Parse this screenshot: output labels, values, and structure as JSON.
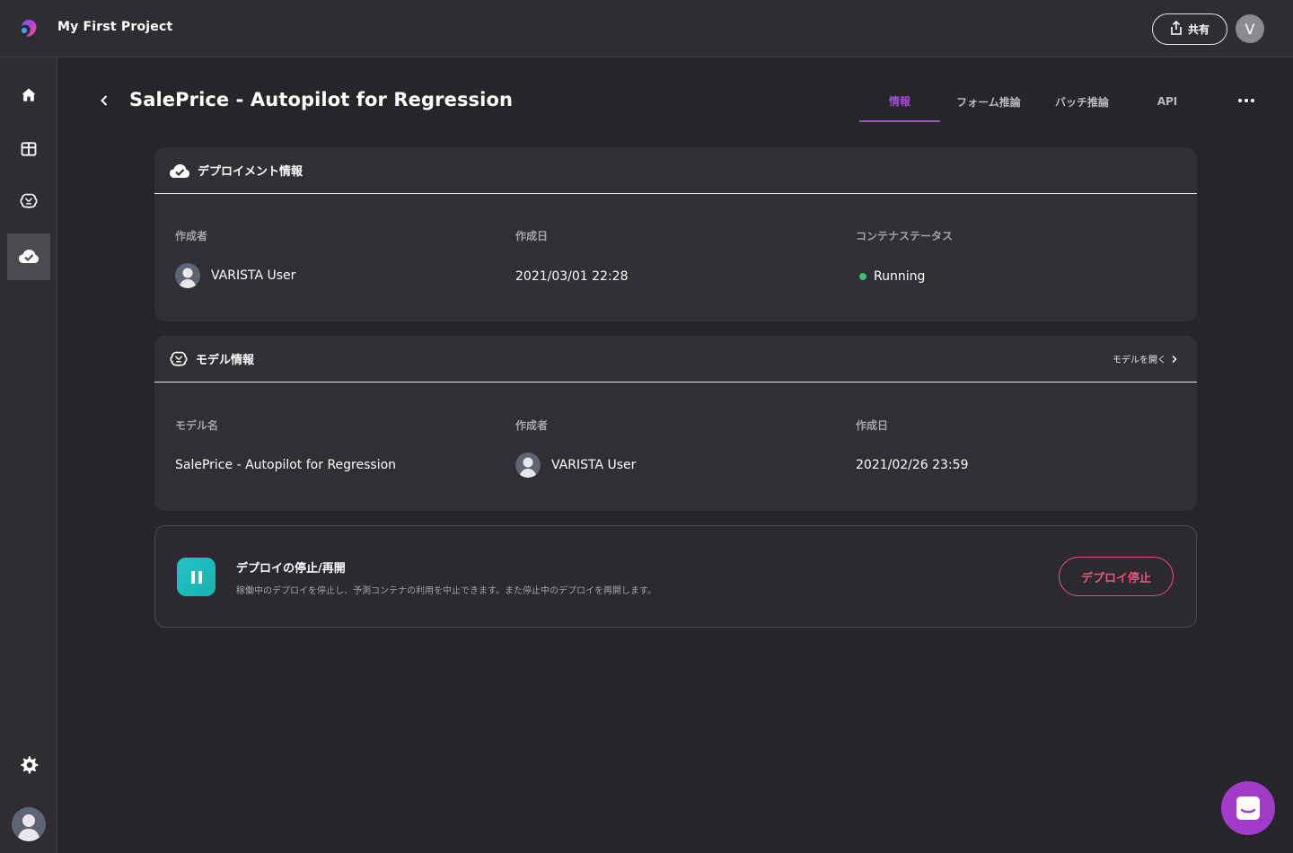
{
  "header": {
    "project_name": "My First Project",
    "share_label": "共有",
    "user_initial": "V"
  },
  "sidebar": {
    "items": [
      {
        "name": "home",
        "icon": "home-icon"
      },
      {
        "name": "tables",
        "icon": "table-icon"
      },
      {
        "name": "models",
        "icon": "brain-icon"
      },
      {
        "name": "deployments",
        "icon": "cloud-check-icon",
        "active": true
      }
    ],
    "settings_icon": "gear-icon"
  },
  "page": {
    "title": "SalePrice - Autopilot for Regression",
    "tabs": [
      {
        "label": "情報",
        "active": true
      },
      {
        "label": "フォーム推論"
      },
      {
        "label": "バッチ推論"
      },
      {
        "label": "API"
      }
    ]
  },
  "deployment_info": {
    "title": "デプロイメント情報",
    "creator_label": "作成者",
    "creator_value": "VARISTA User",
    "created_label": "作成日",
    "created_value": "2021/03/01 22:28",
    "status_label": "コンテナステータス",
    "status_value": "Running",
    "status_color": "#35c46a"
  },
  "model_info": {
    "title": "モデル情報",
    "open_link": "モデルを開く",
    "name_label": "モデル名",
    "name_value": "SalePrice - Autopilot for Regression",
    "creator_label": "作成者",
    "creator_value": "VARISTA User",
    "created_label": "作成日",
    "created_value": "2021/02/26 23:59"
  },
  "deploy_action": {
    "title": "デプロイの停止/再開",
    "description": "稼働中のデプロイを停止し、予測コンテナの利用を中止できます。また停止中のデプロイを再開します。",
    "button_label": "デプロイ停止",
    "button_color": "#f0507a"
  },
  "colors": {
    "accent": "#a64ad8",
    "background": "#25252a",
    "card": "#2f2f35",
    "chat_button": "#a23bc9"
  }
}
